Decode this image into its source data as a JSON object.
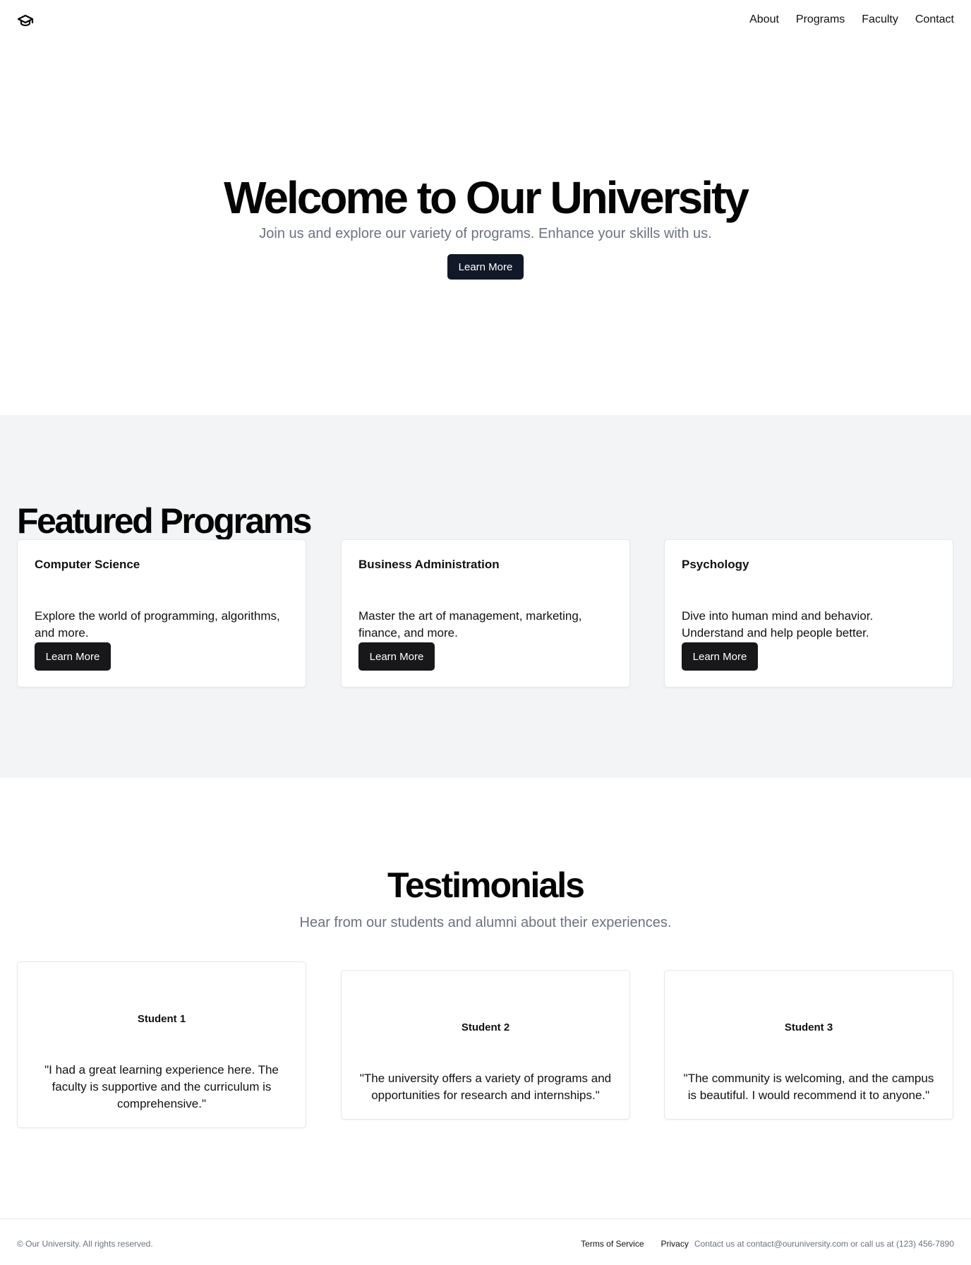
{
  "header": {
    "logo_icon": "graduation-cap-icon",
    "nav": [
      "About",
      "Programs",
      "Faculty",
      "Contact"
    ]
  },
  "hero": {
    "title": "Welcome to Our University",
    "subtitle": "Join us and explore our variety of programs. Enhance your skills with us.",
    "button": "Learn More"
  },
  "programs": {
    "title": "Featured Programs",
    "cards": [
      {
        "title": "Computer Science",
        "description": "Explore the world of programming, algorithms, and more.",
        "button": "Learn More"
      },
      {
        "title": "Business Administration",
        "description": "Master the art of management, marketing, finance, and more.",
        "button": "Learn More"
      },
      {
        "title": "Psychology",
        "description": "Dive into human mind and behavior. Understand and help people better.",
        "button": "Learn More"
      }
    ]
  },
  "testimonials": {
    "title": "Testimonials",
    "subtitle": "Hear from our students and alumni about their experiences.",
    "cards": [
      {
        "name": "Student 1",
        "quote": "\"I had a great learning experience here. The faculty is supportive and the curriculum is comprehensive.\""
      },
      {
        "name": "Student 2",
        "quote": "\"The university offers a variety of programs and opportunities for research and internships.\""
      },
      {
        "name": "Student 3",
        "quote": "\"The community is welcoming, and the campus is beautiful. I would recommend it to anyone.\""
      }
    ]
  },
  "footer": {
    "copyright": "© Our University. All rights reserved.",
    "terms": "Terms of Service",
    "privacy": "Privacy",
    "contact": "Contact us at contact@ouruniversity.com or call us at (123) 456-7890"
  },
  "colors": {
    "primary_button": "#111827",
    "card_button": "#18181b",
    "section_bg": "#f3f4f6",
    "muted_text": "#6b7280"
  }
}
